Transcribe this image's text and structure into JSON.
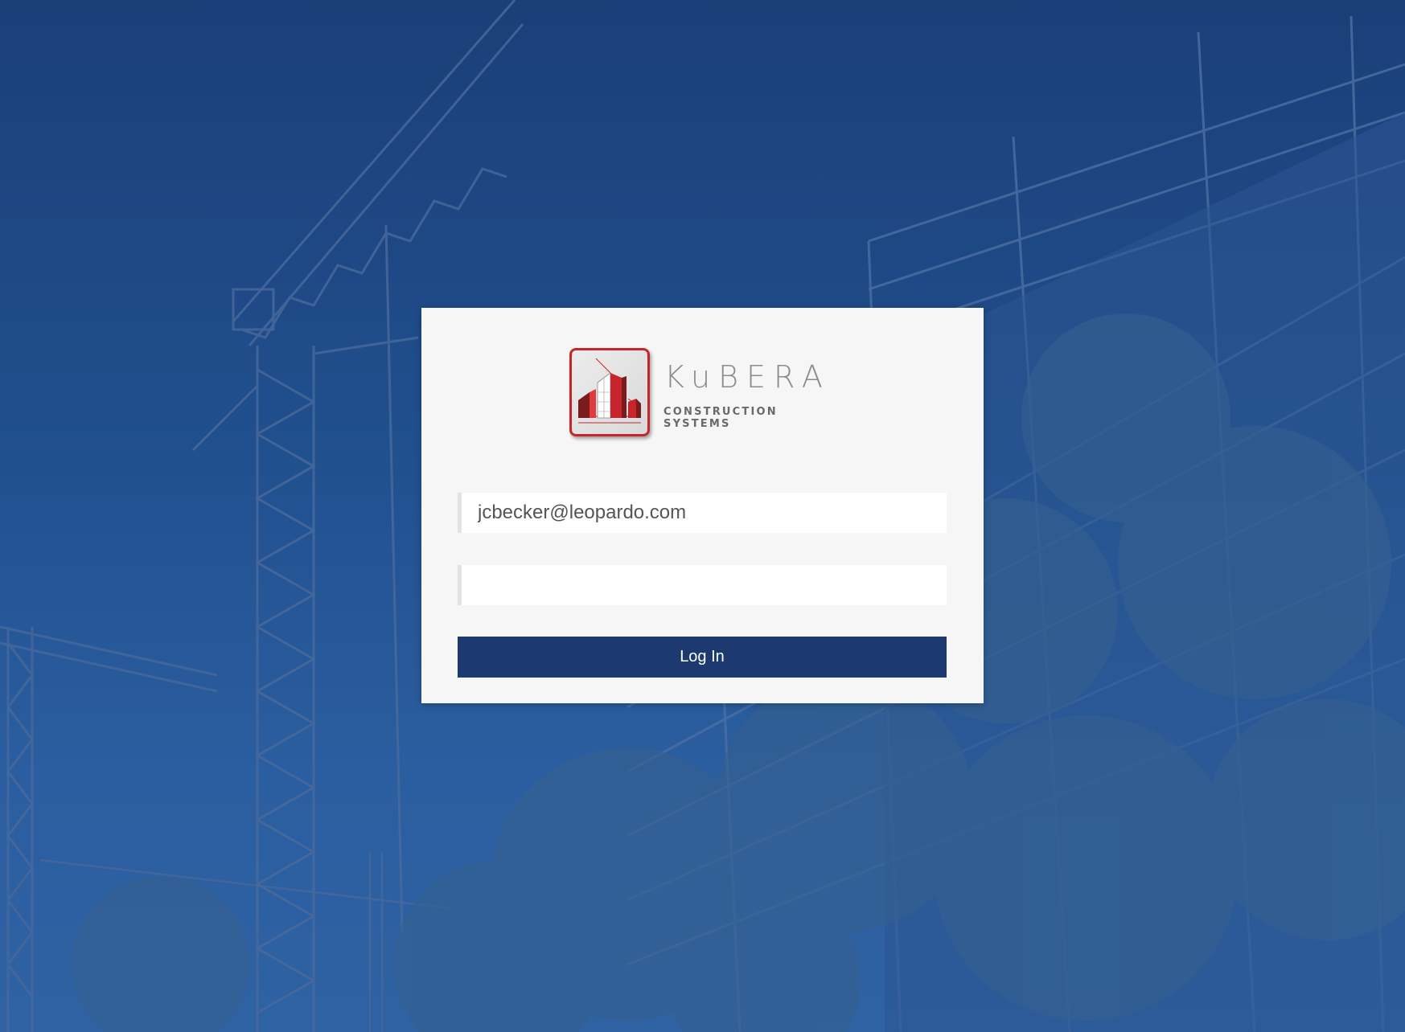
{
  "brand": {
    "name": "KuBERA",
    "tagline": "CONSTRUCTION SYSTEMS"
  },
  "login_form": {
    "email_value": "jcbecker@leopardo.com",
    "password_value": "",
    "submit_label": "Log In"
  },
  "colors": {
    "overlay_blue": "#21508f",
    "button_blue": "#1c3a70",
    "logo_red": "#c8242b",
    "card_bg": "#f6f6f6"
  }
}
